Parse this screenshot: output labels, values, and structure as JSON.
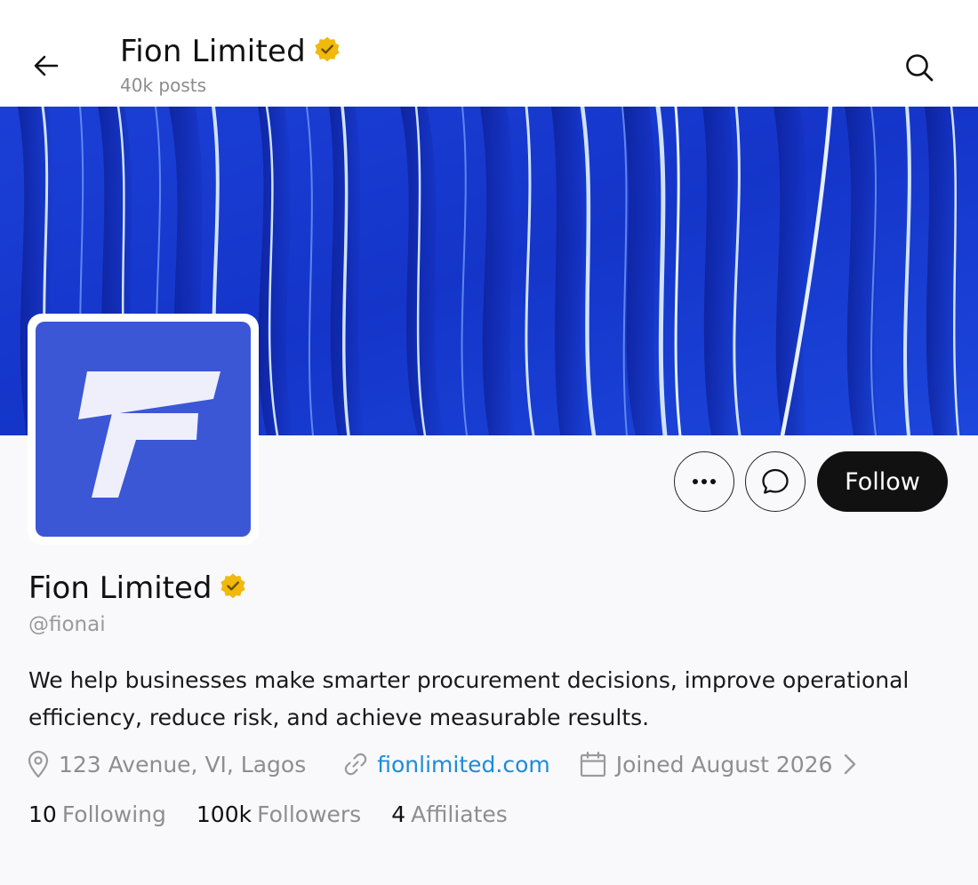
{
  "header": {
    "title": "Fion Limited",
    "posts_count": "40k posts"
  },
  "icons": {
    "back": "arrow-left-icon",
    "search": "search-icon",
    "verified": "verified-badge-icon",
    "more": "more-horizontal-icon",
    "message": "chat-bubble-icon",
    "location": "map-pin-icon",
    "link": "link-icon",
    "calendar": "calendar-icon",
    "chevron": "chevron-right-icon"
  },
  "colors": {
    "banner": "#1d3ed8",
    "avatar_bg": "#3b57d6",
    "verified": "#f0b90b",
    "link": "#1d8cd8",
    "follow_bg": "#111111"
  },
  "actions": {
    "follow_label": "Follow"
  },
  "profile": {
    "name": "Fion Limited",
    "handle": "@fionai",
    "bio": "We help businesses make smarter procurement decisions, improve operational efficiency, reduce risk, and achieve measurable results.",
    "location": "123 Avenue, VI, Lagos",
    "website": "fionlimited.com",
    "joined": "Joined August 2026"
  },
  "stats": {
    "following_count": "10",
    "following_label": "Following",
    "followers_count": "100k",
    "followers_label": "Followers",
    "affiliates_count": "4",
    "affiliates_label": "Affiliates"
  }
}
